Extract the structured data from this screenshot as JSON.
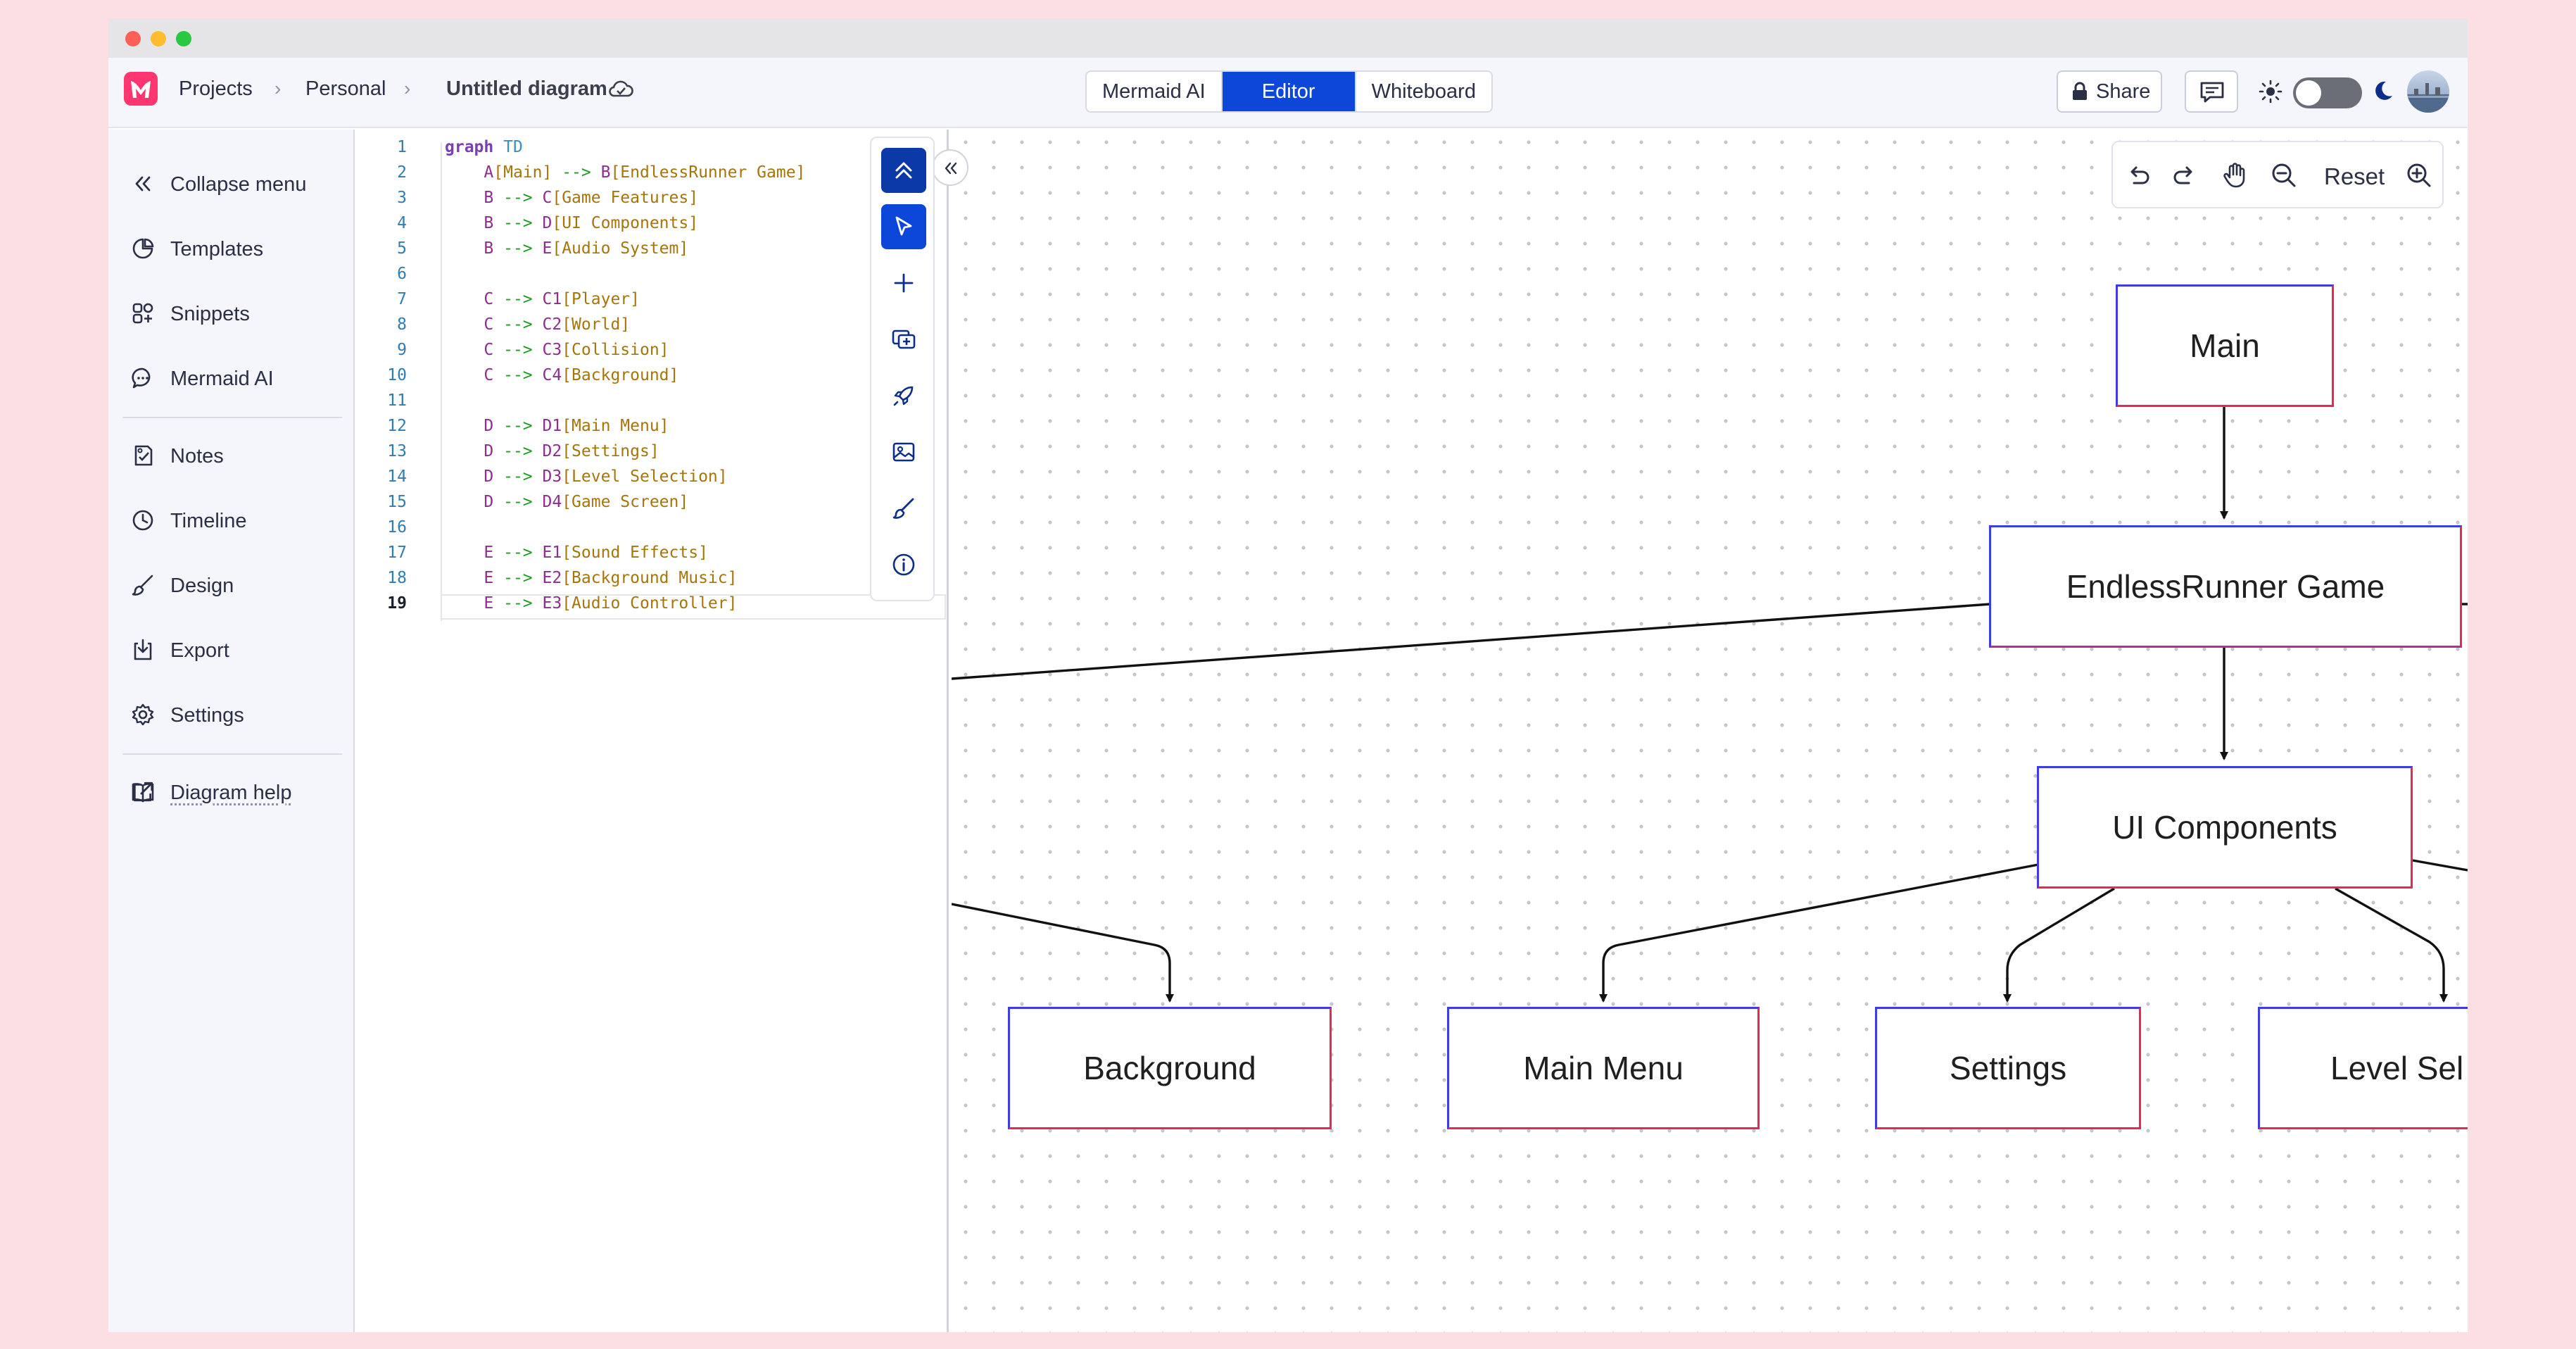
{
  "topbar": {
    "breadcrumbs": [
      "Projects",
      "Personal"
    ],
    "separators": [
      "›",
      "›"
    ],
    "diagram_title": "Untitled diagram",
    "modes": [
      "Mermaid AI",
      "Editor",
      "Whiteboard"
    ],
    "active_mode": "Editor",
    "share_label": "Share"
  },
  "sidebar": {
    "items": [
      {
        "label": "Collapse menu",
        "icon": "double-chevron-left-icon"
      },
      {
        "label": "Templates",
        "icon": "templates-icon"
      },
      {
        "label": "Snippets",
        "icon": "snippets-icon"
      },
      {
        "label": "Mermaid AI",
        "icon": "chat-bubble-icon"
      },
      {
        "label": "Notes",
        "icon": "notes-icon"
      },
      {
        "label": "Timeline",
        "icon": "clock-icon"
      },
      {
        "label": "Design",
        "icon": "brush-icon"
      },
      {
        "label": "Export",
        "icon": "export-icon"
      },
      {
        "label": "Settings",
        "icon": "gear-icon"
      },
      {
        "label": "Diagram help",
        "icon": "book-icon"
      }
    ]
  },
  "editor": {
    "current_line": 19,
    "lines": [
      {
        "n": "1",
        "indent": "",
        "parts": [
          [
            "graph",
            "kw"
          ],
          [
            " TD",
            "dir"
          ]
        ]
      },
      {
        "n": "2",
        "indent": "    ",
        "parts": [
          [
            "A",
            "id"
          ],
          [
            "[Main]",
            "lbl"
          ],
          [
            " --> ",
            "arr"
          ],
          [
            "B",
            "id"
          ],
          [
            "[EndlessRunner Game]",
            "lbl"
          ]
        ]
      },
      {
        "n": "3",
        "indent": "    ",
        "parts": [
          [
            "B",
            "id"
          ],
          [
            " --> ",
            "arr"
          ],
          [
            "C",
            "id"
          ],
          [
            "[Game Features]",
            "lbl"
          ]
        ]
      },
      {
        "n": "4",
        "indent": "    ",
        "parts": [
          [
            "B",
            "id"
          ],
          [
            " --> ",
            "arr"
          ],
          [
            "D",
            "id"
          ],
          [
            "[UI Components]",
            "lbl"
          ]
        ]
      },
      {
        "n": "5",
        "indent": "    ",
        "parts": [
          [
            "B",
            "id"
          ],
          [
            " --> ",
            "arr"
          ],
          [
            "E",
            "id"
          ],
          [
            "[Audio System]",
            "lbl"
          ]
        ]
      },
      {
        "n": "6",
        "indent": "",
        "parts": []
      },
      {
        "n": "7",
        "indent": "    ",
        "parts": [
          [
            "C",
            "id"
          ],
          [
            " --> ",
            "arr"
          ],
          [
            "C1",
            "id"
          ],
          [
            "[Player]",
            "lbl"
          ]
        ]
      },
      {
        "n": "8",
        "indent": "    ",
        "parts": [
          [
            "C",
            "id"
          ],
          [
            " --> ",
            "arr"
          ],
          [
            "C2",
            "id"
          ],
          [
            "[World]",
            "lbl"
          ]
        ]
      },
      {
        "n": "9",
        "indent": "    ",
        "parts": [
          [
            "C",
            "id"
          ],
          [
            " --> ",
            "arr"
          ],
          [
            "C3",
            "id"
          ],
          [
            "[Collision]",
            "lbl"
          ]
        ]
      },
      {
        "n": "10",
        "indent": "    ",
        "parts": [
          [
            "C",
            "id"
          ],
          [
            " --> ",
            "arr"
          ],
          [
            "C4",
            "id"
          ],
          [
            "[Background]",
            "lbl"
          ]
        ]
      },
      {
        "n": "11",
        "indent": "",
        "parts": []
      },
      {
        "n": "12",
        "indent": "    ",
        "parts": [
          [
            "D",
            "id"
          ],
          [
            " --> ",
            "arr"
          ],
          [
            "D1",
            "id"
          ],
          [
            "[Main Menu]",
            "lbl"
          ]
        ]
      },
      {
        "n": "13",
        "indent": "    ",
        "parts": [
          [
            "D",
            "id"
          ],
          [
            " --> ",
            "arr"
          ],
          [
            "D2",
            "id"
          ],
          [
            "[Settings]",
            "lbl"
          ]
        ]
      },
      {
        "n": "14",
        "indent": "    ",
        "parts": [
          [
            "D",
            "id"
          ],
          [
            " --> ",
            "arr"
          ],
          [
            "D3",
            "id"
          ],
          [
            "[Level Selection]",
            "lbl"
          ]
        ]
      },
      {
        "n": "15",
        "indent": "    ",
        "parts": [
          [
            "D",
            "id"
          ],
          [
            " --> ",
            "arr"
          ],
          [
            "D4",
            "id"
          ],
          [
            "[Game Screen]",
            "lbl"
          ]
        ]
      },
      {
        "n": "16",
        "indent": "",
        "parts": []
      },
      {
        "n": "17",
        "indent": "    ",
        "parts": [
          [
            "E",
            "id"
          ],
          [
            " --> ",
            "arr"
          ],
          [
            "E1",
            "id"
          ],
          [
            "[Sound Effects]",
            "lbl"
          ]
        ]
      },
      {
        "n": "18",
        "indent": "    ",
        "parts": [
          [
            "E",
            "id"
          ],
          [
            " --> ",
            "arr"
          ],
          [
            "E2",
            "id"
          ],
          [
            "[Background Music]",
            "lbl"
          ]
        ]
      },
      {
        "n": "19",
        "indent": "    ",
        "parts": [
          [
            "E",
            "id"
          ],
          [
            " --> ",
            "arr"
          ],
          [
            "E3",
            "id"
          ],
          [
            "[Audio Controller]",
            "lbl"
          ]
        ]
      }
    ],
    "token_colors": {
      "kw": "#7a3fb3",
      "dir": "#3a8fc7",
      "id": "#8e2c8f",
      "lbl": "#a6750a",
      "arr": "#1f9a1f"
    }
  },
  "canvas": {
    "view_controls": {
      "reset_label": "Reset"
    },
    "nodes": [
      {
        "id": "A",
        "label": "Main"
      },
      {
        "id": "B",
        "label": "EndlessRunner Game"
      },
      {
        "id": "D",
        "label": "UI Components"
      },
      {
        "id": "C4",
        "label": "Background"
      },
      {
        "id": "D1",
        "label": "Main Menu"
      },
      {
        "id": "D2",
        "label": "Settings"
      },
      {
        "id": "D3",
        "label": "Level Sel"
      }
    ]
  },
  "colors": {
    "accent": "#0d47d9",
    "brand": "#ff3670",
    "node_border_left": "#3b3de6",
    "node_border_right": "#e5275a"
  }
}
